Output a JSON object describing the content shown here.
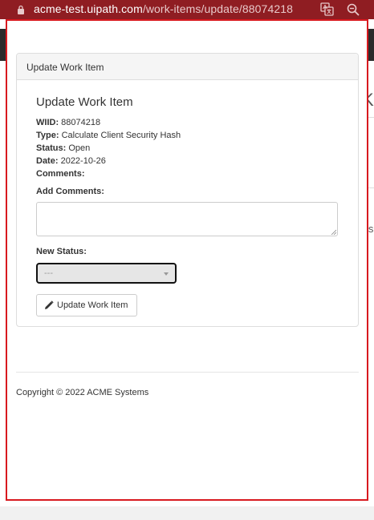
{
  "browser": {
    "url_host": "acme-test.uipath.com",
    "url_path": "/work-items/update/88074218"
  },
  "background": {
    "partial_right_text": "K",
    "partial_mid_text": "ls"
  },
  "panel": {
    "heading": "Update Work Item",
    "title": "Update Work Item"
  },
  "work_item": {
    "wiid_label": "WIID:",
    "wiid_value": "88074218",
    "type_label": "Type:",
    "type_value": "Calculate Client Security Hash",
    "status_label": "Status:",
    "status_value": "Open",
    "date_label": "Date:",
    "date_value": "2022-10-26",
    "comments_label": "Comments:",
    "comments_value": ""
  },
  "form": {
    "add_comments_label": "Add Comments:",
    "add_comments_value": "",
    "new_status_label": "New Status:",
    "new_status_selected": "---",
    "submit_label": "Update Work Item"
  },
  "footer": {
    "copyright": "Copyright © 2022 ACME Systems"
  },
  "colors": {
    "browser_bar": "#8f1d22",
    "popup_border": "#d8191f"
  }
}
